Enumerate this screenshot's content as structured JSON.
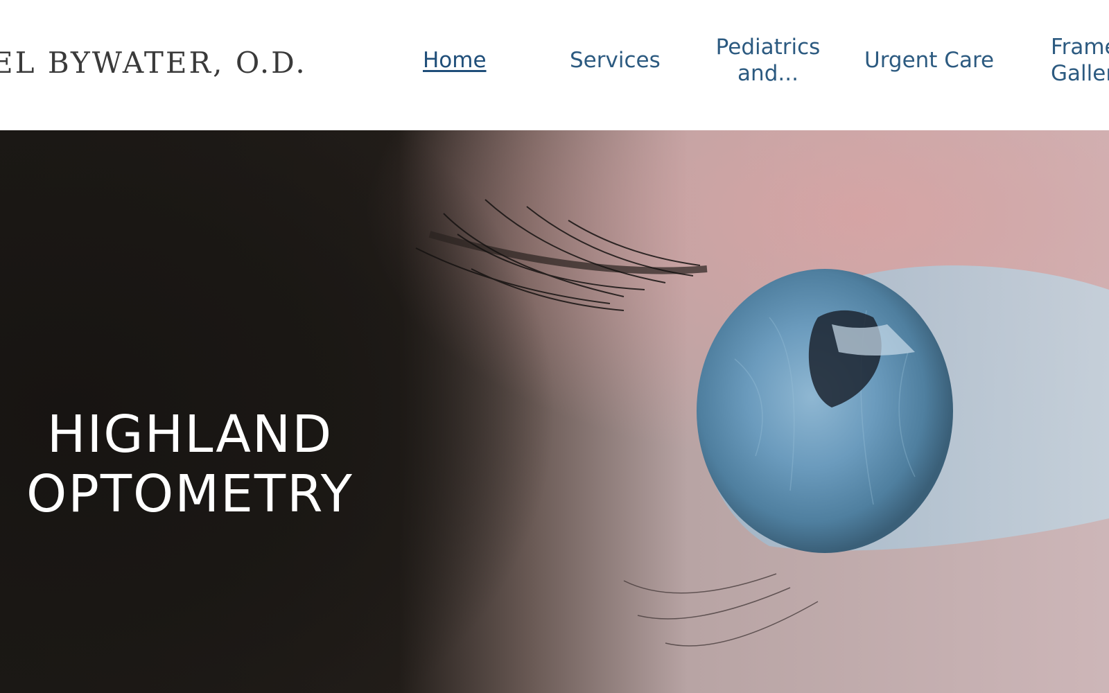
{
  "header": {
    "site_name": "EL BYWATER, O.D.",
    "nav": [
      {
        "label": "Home",
        "active": true
      },
      {
        "label": "Services",
        "active": false
      },
      {
        "label": "Pediatrics and...",
        "active": false
      },
      {
        "label": "Urgent Care",
        "active": false
      },
      {
        "label": "Frame Gallery",
        "active": false
      }
    ]
  },
  "hero": {
    "title": "HIGHLAND OPTOMETRY",
    "image": "close-up-blue-eye-photo"
  },
  "colors": {
    "nav_text": "#2c5a80",
    "hero_dark": "#1c1916",
    "iris_blue": "#5f8fb0"
  }
}
